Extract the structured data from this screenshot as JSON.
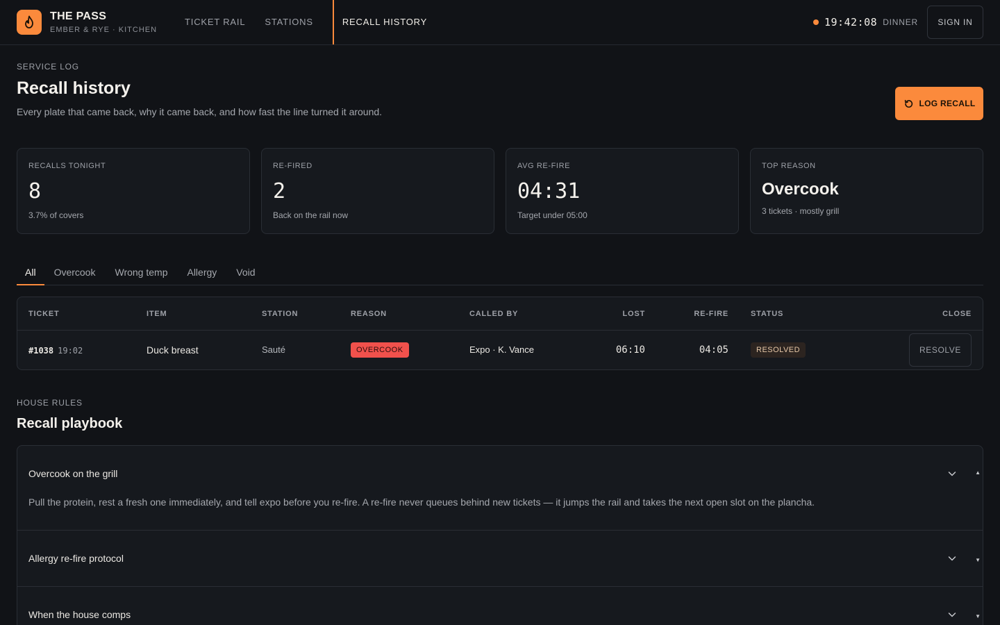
{
  "brand": {
    "name": "THE PASS",
    "subtitle": "EMBER & RYE · KITCHEN"
  },
  "nav": {
    "items": [
      "TICKET RAIL",
      "STATIONS",
      "RECALL HISTORY"
    ],
    "active": "RECALL HISTORY"
  },
  "status": {
    "clock": "19:42:08",
    "service": "DINNER",
    "sign_in": "SIGN IN"
  },
  "header": {
    "eyebrow": "SERVICE LOG",
    "title": "Recall history",
    "subtitle": "Every plate that came back, why it came back, and how fast the line turned it around.",
    "action": "LOG RECALL"
  },
  "stats": [
    {
      "label": "RECALLS TONIGHT",
      "value": "8",
      "note": "3.7% of covers"
    },
    {
      "label": "RE-FIRED",
      "value": "2",
      "note": "Back on the rail now"
    },
    {
      "label": "AVG RE-FIRE",
      "value": "04:31",
      "note": "Target under 05:00"
    },
    {
      "label": "TOP REASON",
      "value": "Overcook",
      "note": "3 tickets · mostly grill"
    }
  ],
  "tabs": [
    "All",
    "Overcook",
    "Wrong temp",
    "Allergy",
    "Void"
  ],
  "table": {
    "columns": [
      "TICKET",
      "ITEM",
      "STATION",
      "REASON",
      "CALLED BY",
      "LOST",
      "RE-FIRE",
      "STATUS",
      "CLOSE"
    ],
    "rows": [
      {
        "ticket": "#1038",
        "time": "19:02",
        "item": "Duck breast",
        "station": "Sauté",
        "reason": "OVERCOOK",
        "called_by": "Expo · K. Vance",
        "lost": "06:10",
        "refire": "04:05",
        "status": "RESOLVED",
        "action": "RESOLVE"
      }
    ]
  },
  "playbook": {
    "eyebrow": "HOUSE RULES",
    "title": "Recall playbook",
    "items": [
      {
        "title": "Overcook on the grill",
        "body": "Pull the protein, rest a fresh one immediately, and tell expo before you re-fire. A re-fire never queues behind new tickets — it jumps the rail and takes the next open slot on the plancha."
      },
      {
        "title": "Allergy re-fire protocol"
      },
      {
        "title": "When the house comps"
      }
    ]
  },
  "colors": {
    "accent": "#fb8a3c",
    "danger": "#f0514c",
    "background": "#111317",
    "panel": "#16191e"
  }
}
